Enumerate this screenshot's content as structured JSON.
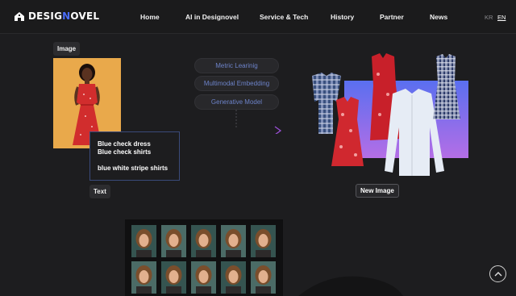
{
  "brand": {
    "logo_part1": "DESIG",
    "logo_part2": "N",
    "logo_part3": "OVEL"
  },
  "nav": {
    "items": [
      "Home",
      "AI in Designovel",
      "Service & Tech",
      "History",
      "Partner",
      "News"
    ],
    "lang_kr": "KR",
    "lang_en": "EN",
    "active_lang": "EN"
  },
  "diagram": {
    "image_label": "Image",
    "text_label": "Text",
    "new_image_label": "New Image",
    "methods": [
      "Metric Learinig",
      "Multimodal Embedding",
      "Generative Model"
    ],
    "text_lines": [
      "Blue check dress",
      "Blue check shirts",
      "",
      "blue white stripe shirts"
    ]
  },
  "colors": {
    "background": "#1d1d1f",
    "accent_blue": "#4a6cf7",
    "method_text": "#6d83c9",
    "arrow_gradient_end": "#9b4fd6",
    "panel_gradient_start": "#5a6ff0",
    "panel_gradient_end": "#b46ee6"
  },
  "icons": {
    "logo": "designovel-logo-icon",
    "scroll_top": "chevron-up-icon",
    "arrow": "arrow-right-icon"
  }
}
